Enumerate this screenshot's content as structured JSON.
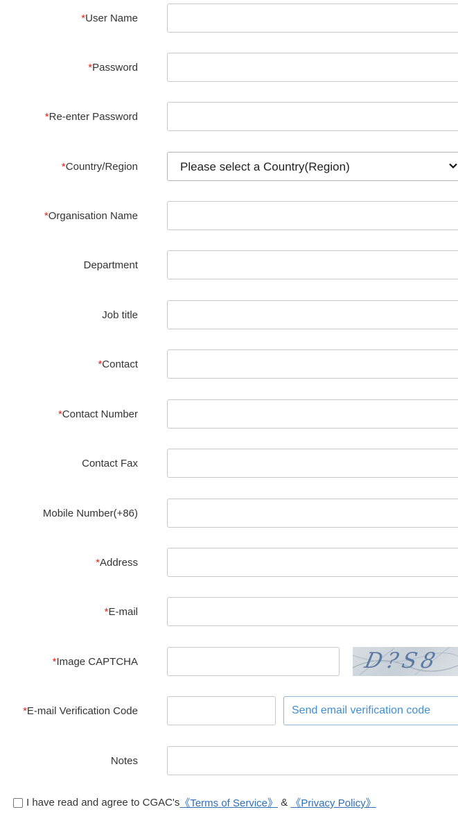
{
  "required_mark": "*",
  "fields": {
    "user_name": "User Name",
    "password": "Password",
    "re_enter_password": "Re-enter Password",
    "country_region": "Country/Region",
    "organisation_name": "Organisation Name",
    "department": "Department",
    "job_title": "Job title",
    "contact": "Contact",
    "contact_number": "Contact Number",
    "contact_fax": "Contact Fax",
    "mobile_number": "Mobile Number(+86)",
    "address": "Address",
    "email": "E-mail",
    "image_captcha": "Image CAPTCHA",
    "email_verification_code": "E-mail Verification Code",
    "notes": "Notes"
  },
  "country_select": {
    "selected": "Please select a Country(Region)"
  },
  "captcha": {
    "text": "D?S8"
  },
  "send_button": "Send email verification code",
  "agreement": {
    "text": "I have read and agree to CGAC's",
    "terms_link": "《Terms of Service》",
    "separator": " & ",
    "privacy_link": "《Privacy Policy》"
  },
  "colors": {
    "required": "#e0241b",
    "link": "#2f6fb8",
    "button_text": "#3f8fd0"
  }
}
